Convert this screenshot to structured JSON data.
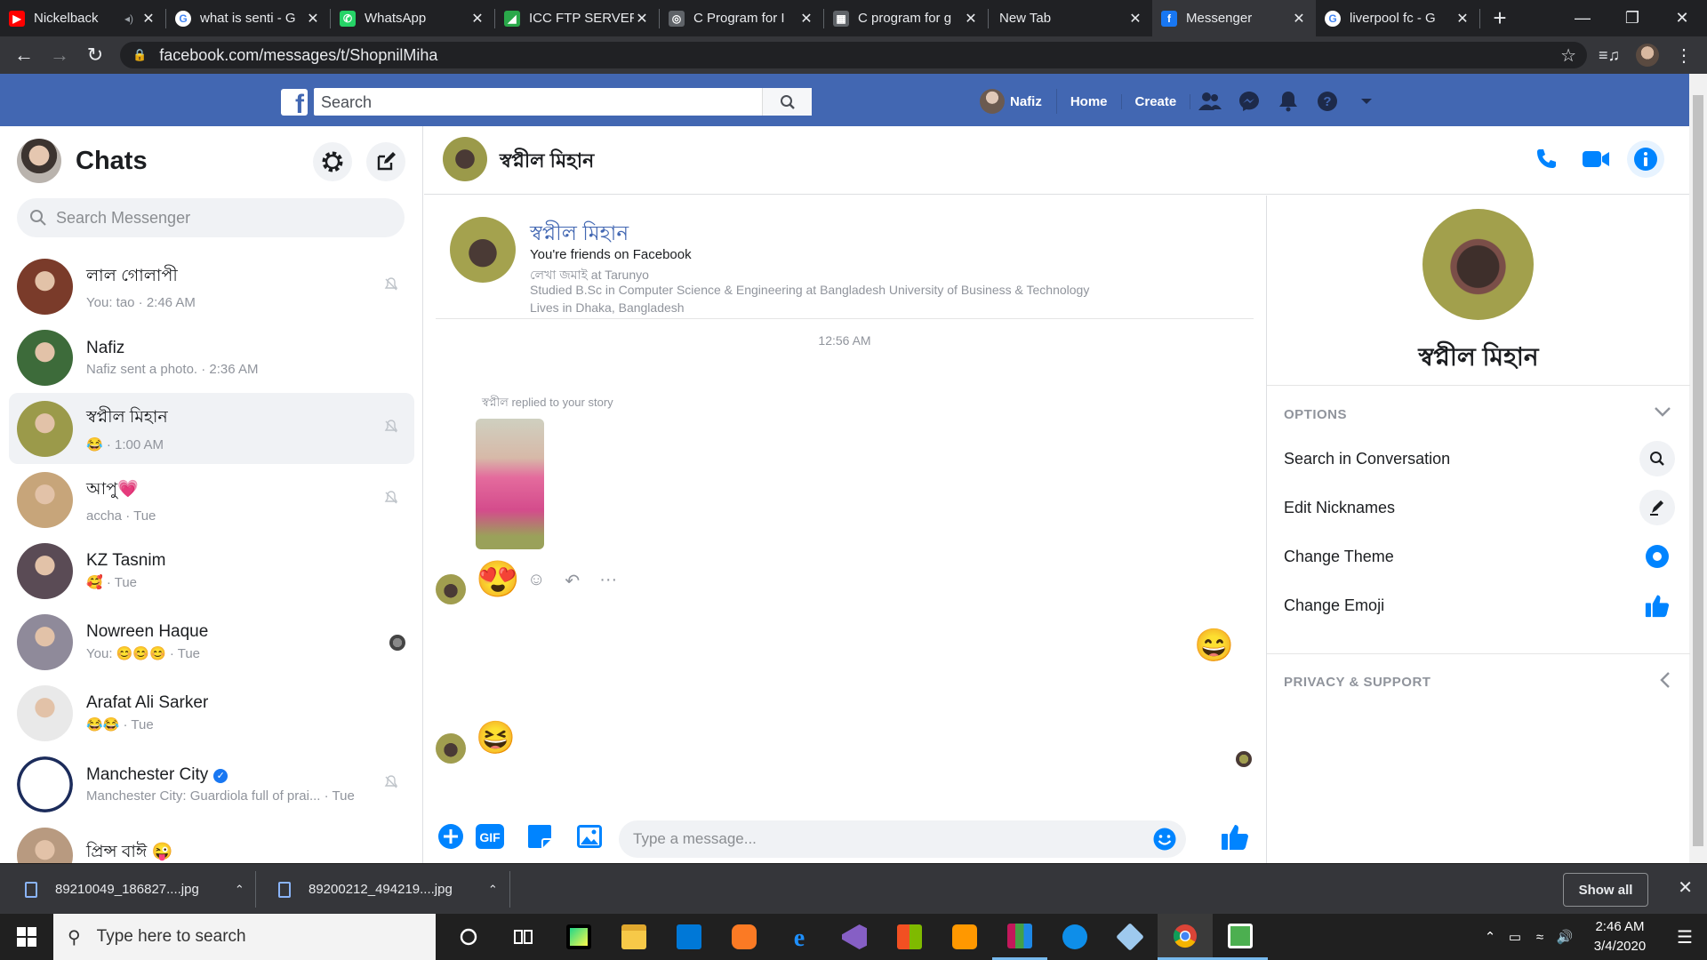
{
  "browser": {
    "tabs": [
      {
        "title": "Nickelback",
        "fav_color": "#ff0000",
        "fav_glyph": "▶",
        "audio": true
      },
      {
        "title": "what is senti - G",
        "fav_color": "#ffffff",
        "fav_glyph": "G"
      },
      {
        "title": "WhatsApp",
        "fav_color": "#25d366",
        "fav_glyph": "✆"
      },
      {
        "title": "ICC FTP SERVER",
        "fav_color": "#2aa84a",
        "fav_glyph": "◢"
      },
      {
        "title": "C Program for I",
        "fav_color": "#5f6368",
        "fav_glyph": "◎"
      },
      {
        "title": "C program for g",
        "fav_color": "#5f6368",
        "fav_glyph": "▦"
      },
      {
        "title": "New Tab",
        "fav_color": "",
        "fav_glyph": ""
      },
      {
        "title": "Messenger",
        "fav_color": "#1877f2",
        "fav_glyph": "f",
        "active": true
      },
      {
        "title": "liverpool fc - G",
        "fav_color": "#ffffff",
        "fav_glyph": "G"
      }
    ],
    "url": "facebook.com/messages/t/ShopnilMiha"
  },
  "fb": {
    "search_placeholder": "Search",
    "user_name": "Nafiz",
    "home": "Home",
    "create": "Create"
  },
  "left": {
    "title": "Chats",
    "search_placeholder": "Search Messenger",
    "chats": [
      {
        "name": "লাল গোলাপী",
        "sub": "You: tao · 2:46 AM",
        "muted": true,
        "avatar": "#7a3b2a"
      },
      {
        "name": "Nafiz",
        "sub": "Nafiz sent a photo. · 2:36 AM",
        "muted": false,
        "avatar": "#3d6b3a"
      },
      {
        "name": "স্বপ্নীল মিহান",
        "sub": "😂 · 1:00 AM",
        "muted": true,
        "avatar": "#9b9a4a",
        "selected": true
      },
      {
        "name": "আপু💗",
        "sub": "accha · Tue",
        "muted": true,
        "avatar": "#c7a57a"
      },
      {
        "name": "KZ Tasnim",
        "sub": "🥰 · Tue",
        "muted": false,
        "avatar": "#5a4b55"
      },
      {
        "name": "Nowreen Haque",
        "sub": "You: 😊😊😊 · Tue",
        "muted": false,
        "seen": true,
        "avatar": "#8f8a9a"
      },
      {
        "name": "Arafat Ali Sarker",
        "sub": "😂😂 · Tue",
        "muted": false,
        "avatar": "#e9e9e9"
      },
      {
        "name": "Manchester City",
        "sub": "Manchester City: Guardiola full of prai... · Tue",
        "muted": true,
        "verified": true,
        "avatar": "#6cabdd"
      },
      {
        "name": "প্রিন্স বাঈ 😜",
        "sub": "",
        "muted": false,
        "avatar": "#b89a80"
      }
    ]
  },
  "conv": {
    "name": "স্বপ্নীল মিহান",
    "intro": {
      "name": "স্বপ্নীল মিহান",
      "friends": "You're friends on Facebook",
      "work": "লেখা জমাই at Tarunyo",
      "study": "Studied B.Sc in Computer Science & Engineering at Bangladesh University of Business & Technology",
      "lives": "Lives in Dhaka, Bangladesh"
    },
    "timestamp": "12:56 AM",
    "story_note": "স্বপ্নীল replied to your story",
    "msg_emoji_1": "😍",
    "msg_emoji_2": "😄",
    "msg_emoji_3": "😆",
    "composer_placeholder": "Type a message..."
  },
  "info": {
    "name": "স্বপ্নীল মিহান",
    "options_label": "OPTIONS",
    "rows": [
      "Search in Conversation",
      "Edit Nicknames",
      "Change Theme",
      "Change Emoji"
    ],
    "privacy_label": "PRIVACY & SUPPORT"
  },
  "downloads": {
    "items": [
      "89210049_186827....jpg",
      "89200212_494219....jpg"
    ],
    "show_all": "Show all"
  },
  "taskbar": {
    "search_placeholder": "Type here to search",
    "time": "2:46 AM",
    "date": "3/4/2020"
  },
  "colors": {
    "fb_blue": "#4267b2",
    "messenger_blue": "#0084ff"
  }
}
